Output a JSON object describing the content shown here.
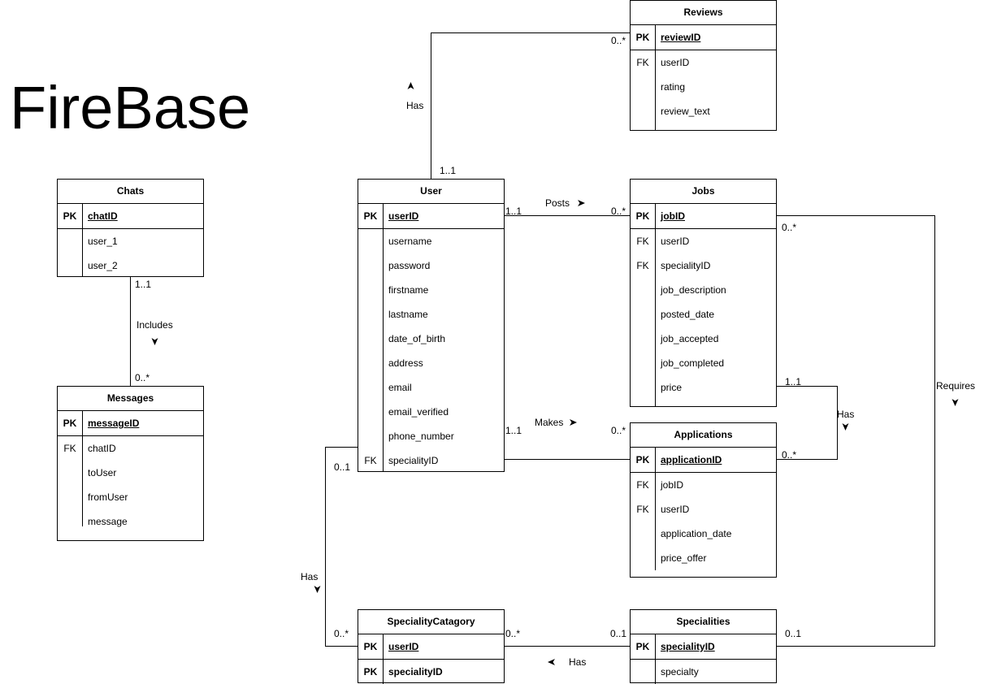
{
  "page_title": "FireBase",
  "entities": {
    "reviews": {
      "name": "Reviews",
      "pk_key": "PK",
      "pk_field": "reviewID",
      "fields": [
        {
          "key": "FK",
          "name": "userID"
        },
        {
          "key": "",
          "name": "rating"
        },
        {
          "key": "",
          "name": "review_text"
        }
      ]
    },
    "chats": {
      "name": "Chats",
      "pk_key": "PK",
      "pk_field": "chatID",
      "fields": [
        {
          "key": "",
          "name": "user_1"
        },
        {
          "key": "",
          "name": "user_2"
        }
      ]
    },
    "user": {
      "name": "User",
      "pk_key": "PK",
      "pk_field": "userID",
      "fields": [
        {
          "key": "",
          "name": "username"
        },
        {
          "key": "",
          "name": "password"
        },
        {
          "key": "",
          "name": "firstname"
        },
        {
          "key": "",
          "name": "lastname"
        },
        {
          "key": "",
          "name": "date_of_birth"
        },
        {
          "key": "",
          "name": "address"
        },
        {
          "key": "",
          "name": "email"
        },
        {
          "key": "",
          "name": "email_verified"
        },
        {
          "key": "",
          "name": "phone_number"
        },
        {
          "key": "FK",
          "name": "specialityID"
        }
      ]
    },
    "jobs": {
      "name": "Jobs",
      "pk_key": "PK",
      "pk_field": "jobID",
      "fields": [
        {
          "key": "FK",
          "name": "userID"
        },
        {
          "key": "FK",
          "name": "specialityID"
        },
        {
          "key": "",
          "name": "job_description"
        },
        {
          "key": "",
          "name": "posted_date"
        },
        {
          "key": "",
          "name": "job_accepted"
        },
        {
          "key": "",
          "name": "job_completed"
        },
        {
          "key": "",
          "name": "price"
        }
      ]
    },
    "messages": {
      "name": "Messages",
      "pk_key": "PK",
      "pk_field": "messageID",
      "fields": [
        {
          "key": "FK",
          "name": "chatID"
        },
        {
          "key": "",
          "name": "toUser"
        },
        {
          "key": "",
          "name": "fromUser"
        },
        {
          "key": "",
          "name": "message"
        }
      ]
    },
    "applications": {
      "name": "Applications",
      "pk_key": "PK",
      "pk_field": "applicationID",
      "fields": [
        {
          "key": "FK",
          "name": "jobID"
        },
        {
          "key": "FK",
          "name": "userID"
        },
        {
          "key": "",
          "name": "application_date"
        },
        {
          "key": "",
          "name": "price_offer"
        }
      ]
    },
    "speciality_catagory": {
      "name": "SpecialityCatagory",
      "pk_key": "PK",
      "pk_field": "userID",
      "pk2_key": "PK",
      "pk2_field": "specialityID"
    },
    "specialities": {
      "name": "Specialities",
      "pk_key": "PK",
      "pk_field": "specialityID",
      "fields": [
        {
          "key": "",
          "name": "specialty"
        }
      ]
    }
  },
  "relationships": {
    "user_reviews": {
      "label": "Has",
      "from_card": "1..1",
      "to_card": "0..*"
    },
    "user_jobs": {
      "label": "Posts",
      "from_card": "1..1",
      "to_card": "0..*"
    },
    "chats_messages": {
      "label": "Includes",
      "from_card": "1..1",
      "to_card": "0..*"
    },
    "user_applications": {
      "label": "Makes",
      "from_card": "1..1",
      "to_card": "0..*"
    },
    "jobs_applications": {
      "label": "Has",
      "from_card": "1..1",
      "to_card": "0..*"
    },
    "jobs_specialities": {
      "label": "Requires",
      "from_card": "0..*",
      "to_card": "0..1"
    },
    "user_specialitycatagory": {
      "label": "Has",
      "from_card": "0..1",
      "to_card": "0..*"
    },
    "specialities_specialitycatagory": {
      "label": "Has",
      "from_card": "0..1",
      "to_card": "0..*"
    }
  }
}
